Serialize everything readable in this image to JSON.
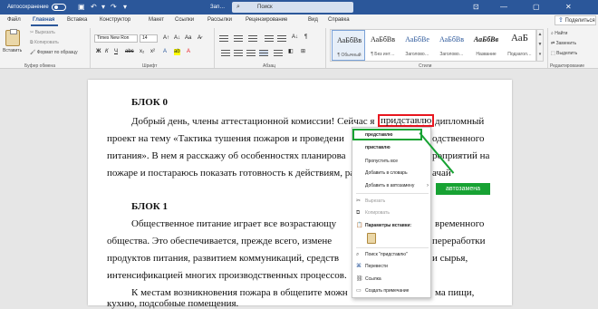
{
  "titlebar": {
    "autosave_label": "Автосохранение",
    "doc_title": "Зап…",
    "search_placeholder": "Поиск"
  },
  "tabs": [
    "Файл",
    "Главная",
    "Вставка",
    "Конструктор",
    "Макет",
    "Ссылки",
    "Рассылки",
    "Рецензирование",
    "Вид",
    "Справка"
  ],
  "share_label": "Поделиться",
  "ribbon": {
    "clipboard": {
      "paste": "Вставить",
      "cut": "Вырезать",
      "copy": "Копировать",
      "format_painter": "Формат по образцу",
      "group_label": "Буфер обмена"
    },
    "font": {
      "font_name": "Times New Ron",
      "font_size": "14",
      "group_label": "Шрифт"
    },
    "paragraph": {
      "group_label": "Абзац"
    },
    "styles": {
      "items": [
        {
          "sample": "АаБбВв",
          "name": "¶ Обычный"
        },
        {
          "sample": "АаБбВв",
          "name": "¶ Без инт…"
        },
        {
          "sample": "АаБбВе",
          "name": "Заголово…"
        },
        {
          "sample": "АаБбВв",
          "name": "Заголово…"
        },
        {
          "sample": "АаБбВв",
          "name": "Название"
        },
        {
          "sample": "АаБ",
          "name": "Подзагол…"
        }
      ],
      "group_label": "Стили"
    },
    "editing": {
      "find": "Найти",
      "replace": "Заменить",
      "select": "Выделить",
      "group_label": "Редактирование"
    }
  },
  "document": {
    "block0_heading": "БЛОК 0",
    "p1_line1_before": "Добрый день, члены аттестационной комиссии! Сейчас я",
    "p1_misspelled": "придставлю",
    "p1_line1_after": "дипломный",
    "p1_line2": "проект на тему «Тактика тушения пожаров и проведени",
    "p1_line2_end": "одственного",
    "p1_line3": "питания». В нем я расскажу об особенностях планирова",
    "p1_line3_end": "роприятий на",
    "p1_line4": "пожаре и постараюсь показать готовность к действиям, ра",
    "p1_line4_end": "ачай",
    "block1_heading": "БЛОК 1",
    "p2_line1": "Общественное питание играет все возрастающу",
    "p2_line1_end": "временного",
    "p2_line2": "общества. Это обеспечивается, прежде всего, измене",
    "p2_line2_end": "переработки",
    "p2_line3": "продуктов питания, развитием коммуникаций, средств",
    "p2_line3_end": "и сырья,",
    "p2_line4": "интенсификацией многих производственных процессов.",
    "p3_line1": "К местам возникновения пожара в общепите можн",
    "p3_line1_end": "ма пищи,",
    "p3_line2": "кухню, подсобные помещения."
  },
  "context_menu": {
    "suggestion_1": "представлю",
    "suggestion_2": "приставлю",
    "skip_all": "Пропустить все",
    "add_dictionary": "Добавить в словарь",
    "add_autocorrect": "Добавить в автозамену",
    "cut": "Вырезать",
    "copy": "Копировать",
    "paste_options": "Параметры вставки:",
    "search": "Поиск \"придставлю\"",
    "translate": "Перевести",
    "link": "Ссылка",
    "new_comment": "Создать примечание"
  },
  "annotation": {
    "label": "автозамена",
    "color": "#17a233"
  },
  "colors": {
    "word_blue": "#2b579a",
    "highlight_red": "#e8171f"
  }
}
